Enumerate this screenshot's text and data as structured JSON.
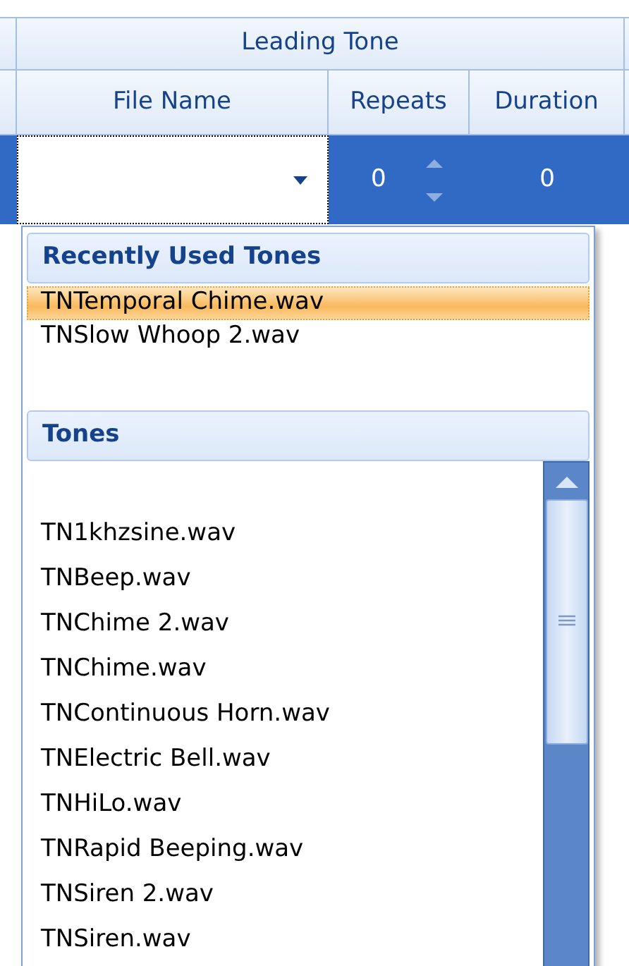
{
  "grid": {
    "group_header": "Leading Tone",
    "columns": [
      "File Name",
      "Repeats",
      "Duration"
    ],
    "row": {
      "repeats": "0",
      "duration": "0",
      "selected": true
    }
  },
  "dropdown": {
    "sections": [
      {
        "title": "Recently Used Tones",
        "scrollable": false,
        "items": [
          {
            "label": "TNTemporal Chime.wav",
            "selected": true
          },
          {
            "label": "TNSlow Whoop 2.wav",
            "selected": false
          }
        ]
      },
      {
        "title": "Tones",
        "scrollable": true,
        "items": [
          {
            "label": "TN1khzsine.wav",
            "selected": false
          },
          {
            "label": "TNBeep.wav",
            "selected": false
          },
          {
            "label": "TNChime 2.wav",
            "selected": false
          },
          {
            "label": "TNChime.wav",
            "selected": false
          },
          {
            "label": "TNContinuous Horn.wav",
            "selected": false
          },
          {
            "label": "TNElectric Bell.wav",
            "selected": false
          },
          {
            "label": "TNHiLo.wav",
            "selected": false
          },
          {
            "label": "TNRapid Beeping.wav",
            "selected": false
          },
          {
            "label": "TNSiren 2.wav",
            "selected": false
          },
          {
            "label": "TNSiren.wav",
            "selected": false
          }
        ]
      }
    ]
  }
}
